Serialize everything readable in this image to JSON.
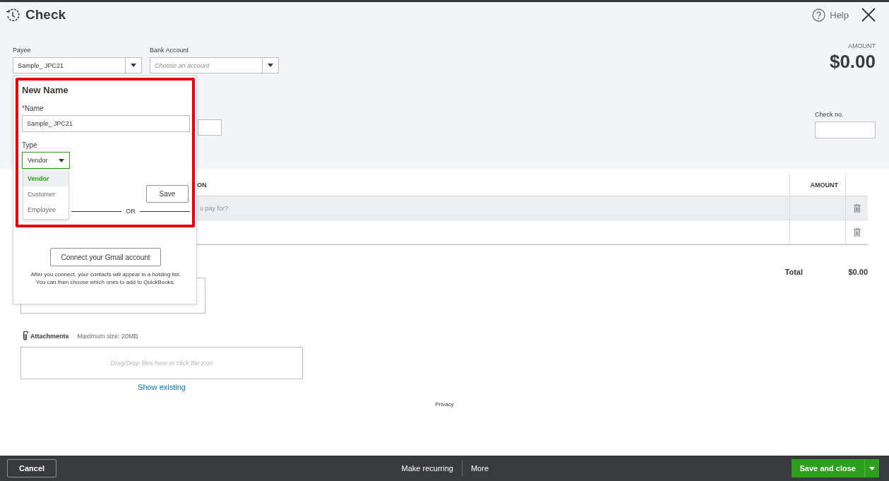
{
  "header": {
    "title": "Check",
    "help": "Help"
  },
  "payee": {
    "label": "Payee",
    "value": "Sample_ JPC21"
  },
  "bank_account": {
    "label": "Bank Account",
    "placeholder": "Choose an account"
  },
  "amount": {
    "label": "AMOUNT",
    "value": "$0.00"
  },
  "check_no": {
    "label": "Check no."
  },
  "table": {
    "columns": [
      "ON",
      "AMOUNT"
    ],
    "rows": [
      {
        "description_placeholder": "u pay for?",
        "highlighted": true
      },
      {
        "highlighted": false
      }
    ]
  },
  "total": {
    "label": "Total",
    "value": "$0.00"
  },
  "attachments": {
    "label": "Attachments",
    "max_size": "Maximum size: 20MB",
    "drop_hint": "Drag/Drop files here or click the icon",
    "show_existing": "Show existing"
  },
  "privacy": "Privacy",
  "new_name_popup": {
    "title": "New Name",
    "required_mark": "*",
    "name_label": "Name",
    "name_value": "Sample_ JPC21",
    "type_label": "Type",
    "type_value": "Vendor",
    "type_options": [
      {
        "label": "Vendor",
        "selected": true
      },
      {
        "label": "Customer",
        "selected": false
      },
      {
        "label": "Employee",
        "selected": false
      }
    ],
    "save": "Save",
    "or": "OR",
    "gmail_button": "Connect your Gmail account",
    "gmail_note": [
      "After you connect, your contacts will appear in a holding list.",
      "You can then choose which ones to add to QuickBooks."
    ]
  },
  "footer": {
    "cancel": "Cancel",
    "make_recurring": "Make recurring",
    "more": "More",
    "save_and_close": "Save and close"
  }
}
